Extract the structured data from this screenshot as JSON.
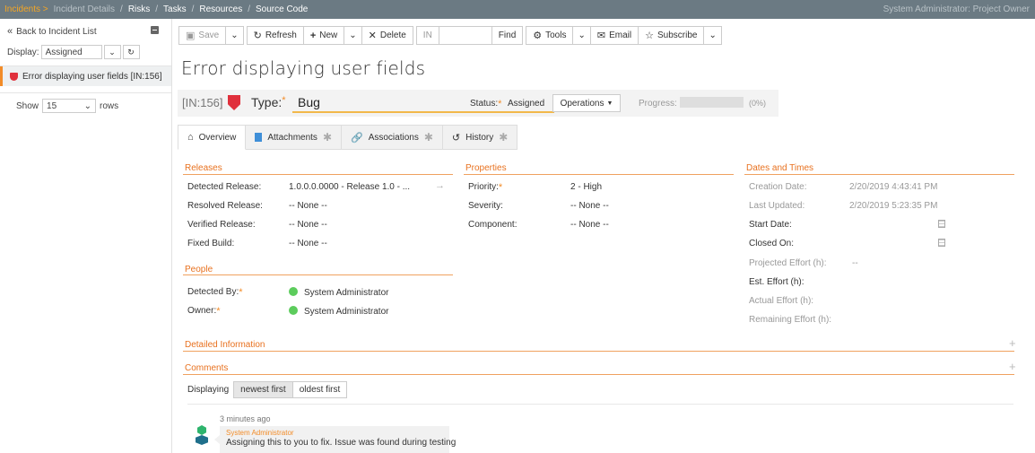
{
  "topnav": {
    "items": [
      "Incidents >",
      "Incident Details",
      "/",
      "Risks",
      "/",
      "Tasks",
      "/",
      "Resources",
      "/",
      "Source Code"
    ],
    "user": "System Administrator: Project Owner"
  },
  "sidebar": {
    "back_label": "Back to Incident List",
    "display_label": "Display:",
    "display_value": "Assigned",
    "incident_item": "Error displaying user fields [IN:156]",
    "show_label": "Show",
    "show_value": "15",
    "rows_label": "rows"
  },
  "toolbar": {
    "save": "Save",
    "refresh": "Refresh",
    "new": "New",
    "delete": "Delete",
    "id_prefix": "IN",
    "find": "Find",
    "tools": "Tools",
    "email": "Email",
    "subscribe": "Subscribe"
  },
  "incident": {
    "title": "Error displaying user fields",
    "id": "[IN:156]",
    "type_label": "Type:",
    "type_value": "Bug",
    "status_label": "Status:",
    "status_value": "Assigned",
    "operations": "Operations",
    "progress_label": "Progress:",
    "progress_fraction": 0,
    "progress_text": "(0%)"
  },
  "tabs": [
    {
      "label": "Overview"
    },
    {
      "label": "Attachments"
    },
    {
      "label": "Associations"
    },
    {
      "label": "History"
    }
  ],
  "releases": {
    "title": "Releases",
    "fields": [
      {
        "label": "Detected Release:",
        "value": "1.0.0.0.0000 - Release 1.0 - ..."
      },
      {
        "label": "Resolved Release:",
        "value": "-- None --"
      },
      {
        "label": "Verified Release:",
        "value": "-- None --"
      },
      {
        "label": "Fixed Build:",
        "value": "-- None --"
      }
    ]
  },
  "properties": {
    "title": "Properties",
    "fields": [
      {
        "label": "Priority:",
        "value": "2 - High"
      },
      {
        "label": "Severity:",
        "value": "-- None --"
      },
      {
        "label": "Component:",
        "value": "-- None --"
      }
    ]
  },
  "dates": {
    "title": "Dates and Times",
    "fields": [
      {
        "label": "Creation Date:",
        "value": "2/20/2019 4:43:41 PM"
      },
      {
        "label": "Last Updated:",
        "value": "2/20/2019 5:23:35 PM"
      },
      {
        "label": "Start Date:",
        "value": ""
      },
      {
        "label": "Closed On:",
        "value": ""
      },
      {
        "label": "Projected Effort (h):",
        "value": "--"
      },
      {
        "label": "Est. Effort (h):",
        "value": ""
      },
      {
        "label": "Actual Effort (h):",
        "value": ""
      },
      {
        "label": "Remaining Effort (h):",
        "value": ""
      }
    ]
  },
  "people": {
    "title": "People",
    "fields": [
      {
        "label": "Detected By:",
        "value": "System Administrator"
      },
      {
        "label": "Owner:",
        "value": "System Administrator"
      }
    ]
  },
  "detailed": {
    "title": "Detailed Information"
  },
  "comments": {
    "title": "Comments",
    "displaying_label": "Displaying",
    "newest": "newest first",
    "oldest": "oldest first",
    "items": [
      {
        "time": "3 minutes ago",
        "author": "System Administrator",
        "text": "Assigning this to you to fix. Issue was found during testing"
      }
    ]
  },
  "colors": {
    "accent": "#f28c28",
    "nav": "#6b7a83",
    "bug": "#e0303c",
    "avatar_status": "#5ccc5c"
  }
}
